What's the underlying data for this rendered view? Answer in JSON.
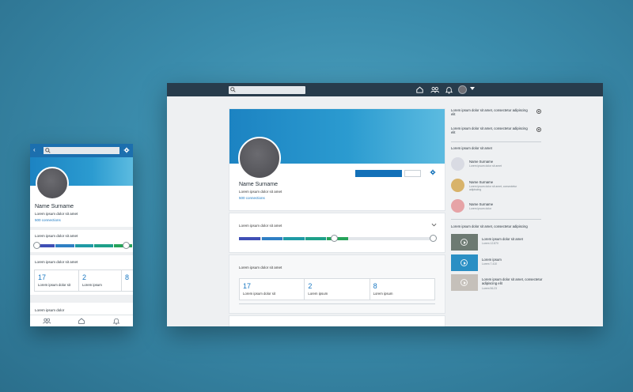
{
  "desktop": {
    "search": {
      "placeholder": ""
    },
    "nav_icons": [
      "home-icon",
      "people-icon",
      "bell-icon"
    ],
    "profile": {
      "name": "Name Surname",
      "subtitle": "Lorem ipsum dolor sit amet",
      "connections": "500 connections"
    },
    "progress_card": {
      "label": "Lorem ipsum dolor sit amet",
      "progress_fraction": 0.56,
      "colors": [
        "#3f4fb5",
        "#2f7fc4",
        "#1f9aa5",
        "#1ea089",
        "#26a35a"
      ]
    },
    "stats_card": {
      "label": "Lorem ipsum dolor sit amet",
      "stats": [
        {
          "value": "17",
          "label": "Lorem ipsum dolor sit"
        },
        {
          "value": "2",
          "label": "Lorem ipsum"
        },
        {
          "value": "8",
          "label": "Lorem ipsum"
        }
      ]
    },
    "right_column": {
      "top_items": [
        {
          "text": "Lorem ipsum dolor sit amet, consectetur adipiscing elit"
        },
        {
          "text": "Lorem ipsum dolor sit amet, consectetur adipiscing elit"
        }
      ],
      "people_heading": "Lorem ipsum dolor sit amet",
      "people": [
        {
          "name": "Name Surname",
          "detail": "Lorem ipsum dolor sit amet",
          "color": "#d9dbe3"
        },
        {
          "name": "Name Surname",
          "detail": "Lorem ipsum dolor sit amet, consectetur adipiscing",
          "color": "#d8b36a"
        },
        {
          "name": "Name Surname",
          "detail": "Lorem ipsum dolor",
          "color": "#e6a3a6"
        }
      ],
      "videos_heading": "Lorem ipsum dolor sit amet, consectetur adipiscing",
      "videos": [
        {
          "title": "Lorem ipsum dolor sit amet",
          "meta": "Lorem 12.870",
          "color": "#6d7a72"
        },
        {
          "title": "Lorem ipsum",
          "meta": "Lorem 7.410",
          "color": "#2a8fc4"
        },
        {
          "title": "Lorem ipsum dolor sit amet, consectetur adipiscing elit",
          "meta": "Lorem 56.23",
          "color": "#c5c0ba"
        }
      ]
    }
  },
  "mobile": {
    "back_label": "‹",
    "search": {
      "placeholder": ""
    },
    "profile": {
      "name": "Name Surname",
      "subtitle": "Lorem ipsum dolor sit amet",
      "connections": "500 connections"
    },
    "progress_card": {
      "label": "Lorem ipsum dolor sit amet"
    },
    "stats_card": {
      "label": "Lorem ipsum dolor sit amet",
      "stats": [
        {
          "value": "17",
          "label": "Lorem ipsum dolor sit"
        },
        {
          "value": "2",
          "label": "Lorem ipsum"
        },
        {
          "value": "8",
          "label": ""
        }
      ]
    },
    "bottom_label": "Lorem ipsum dolor",
    "tab_icons": [
      "people-icon",
      "home-icon",
      "bell-icon"
    ]
  }
}
